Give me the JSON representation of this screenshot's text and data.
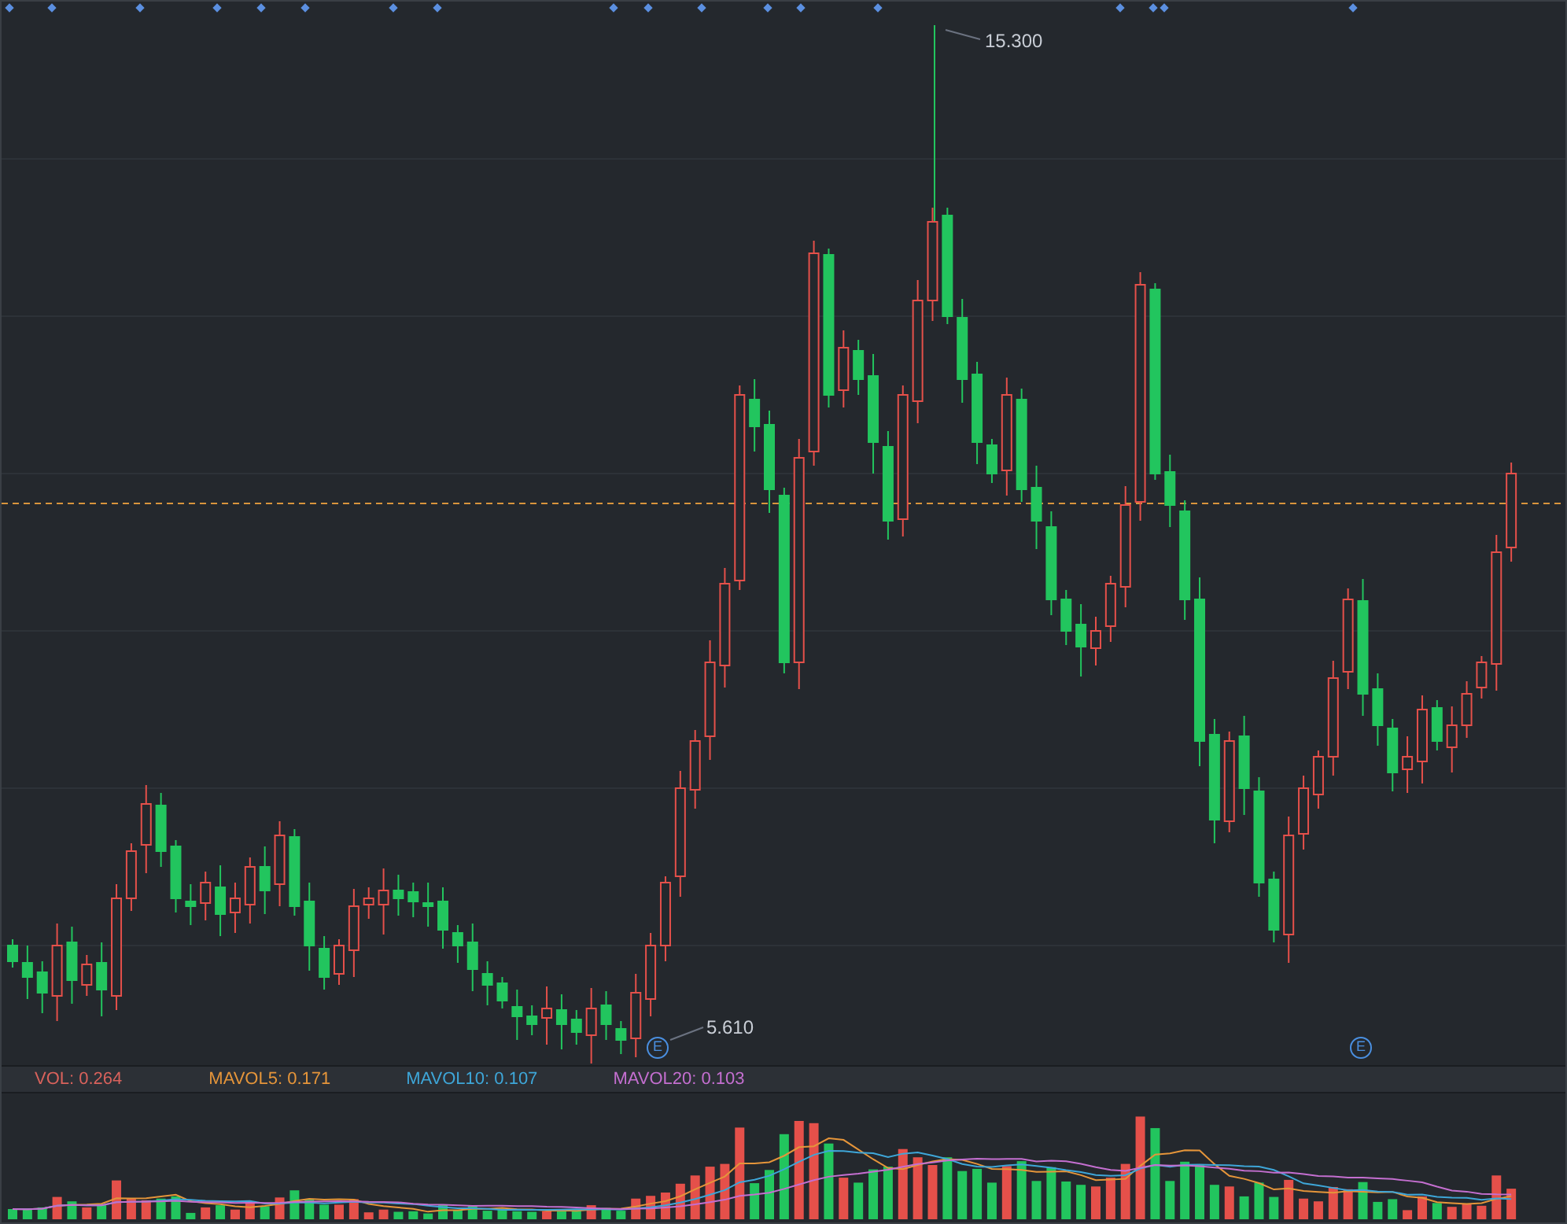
{
  "price_chart": {
    "high_label": "15.300",
    "low_label": "5.610",
    "event_markers": [
      "E",
      "E"
    ]
  },
  "volume_legend": [
    {
      "label": "VOL: 0.264",
      "color": "#d9625c"
    },
    {
      "label": "MAVOL5: 0.171",
      "color": "#e5953a"
    },
    {
      "label": "MAVOL10: 0.107",
      "color": "#3ea6d8"
    },
    {
      "label": "MAVOL20: 0.103",
      "color": "#c46fd0"
    }
  ]
}
